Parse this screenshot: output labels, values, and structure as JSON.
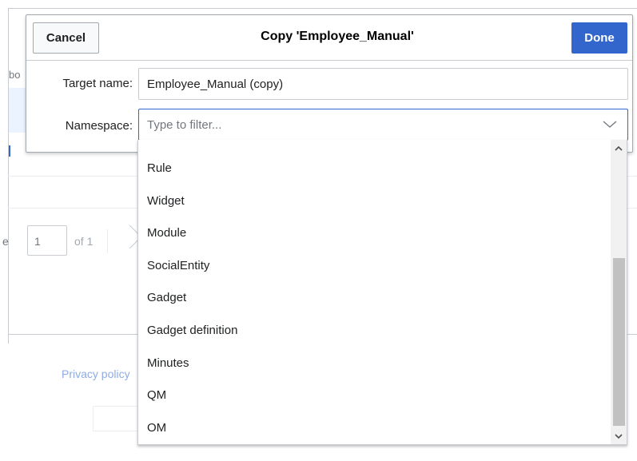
{
  "dialog": {
    "title": "Copy 'Employee_Manual'",
    "cancel_label": "Cancel",
    "done_label": "Done",
    "accent_color": "#3366cc"
  },
  "form": {
    "target_name_label": "Target name:",
    "target_name_value": "Employee_Manual (copy)",
    "namespace_label": "Namespace:",
    "namespace_placeholder": "Type to filter..."
  },
  "namespace_options": [
    "Rule",
    "Widget",
    "Module",
    "SocialEntity",
    "Gadget",
    "Gadget definition",
    "Minutes",
    "QM",
    "OM"
  ],
  "background": {
    "fragment_bo": "bo",
    "page_letter": "e",
    "page_number": "1",
    "page_of": "of 1",
    "privacy_link": "Privacy policy"
  },
  "icons": {
    "namespace_dropdown": "chevron-down-icon",
    "scroll_up": "scroll-up-arrow-icon",
    "scroll_down": "scroll-down-arrow-icon",
    "pager_next": "chevron-right-icon"
  }
}
